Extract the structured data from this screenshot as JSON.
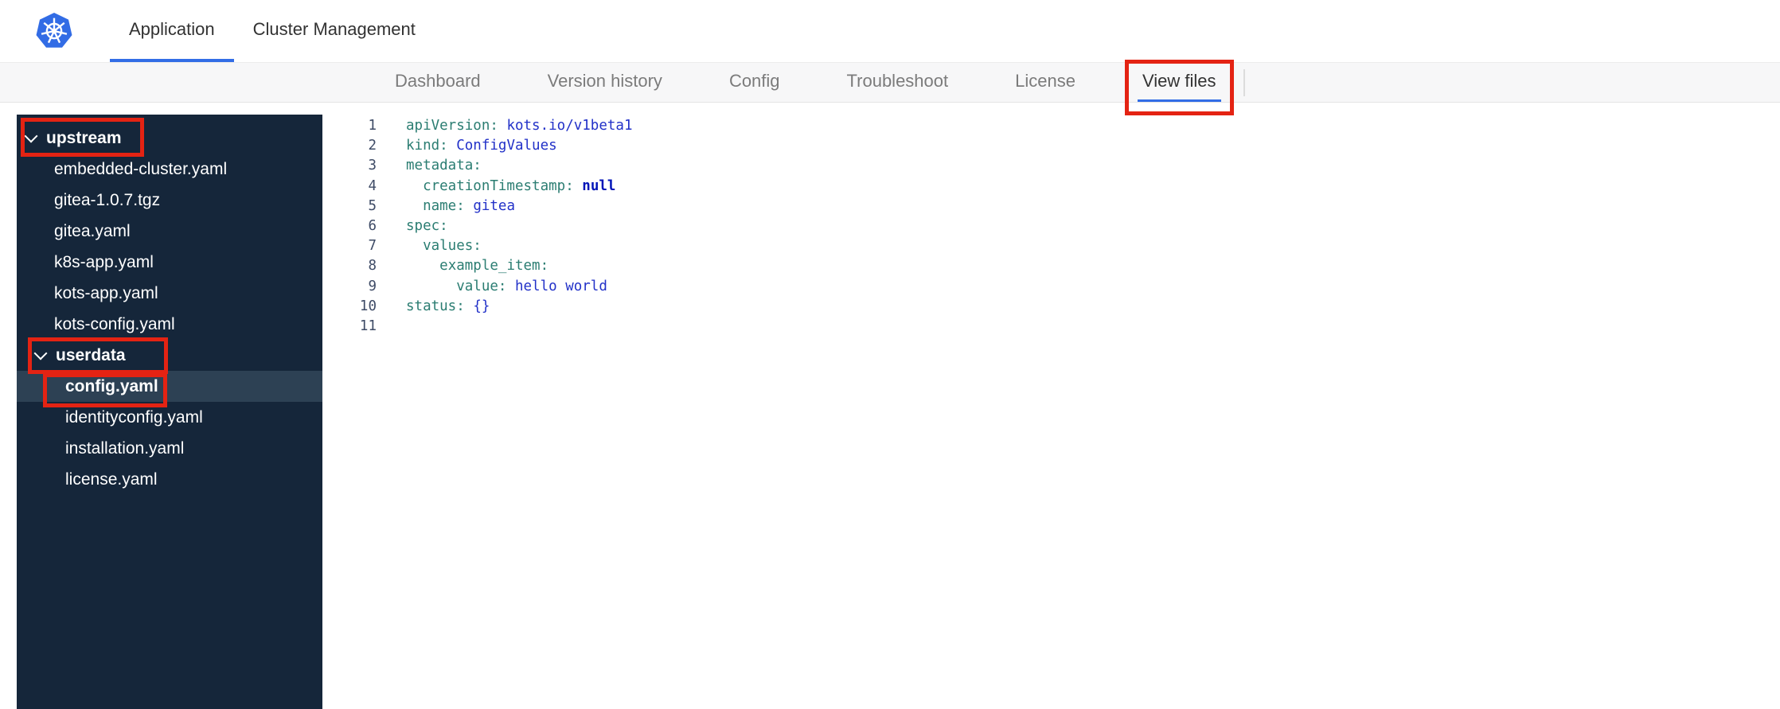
{
  "header": {
    "tabs": [
      {
        "label": "Application",
        "active": true
      },
      {
        "label": "Cluster Management",
        "active": false
      }
    ]
  },
  "subnav": {
    "items": [
      {
        "label": "Dashboard",
        "active": false
      },
      {
        "label": "Version history",
        "active": false
      },
      {
        "label": "Config",
        "active": false
      },
      {
        "label": "Troubleshoot",
        "active": false
      },
      {
        "label": "License",
        "active": false
      },
      {
        "label": "View files",
        "active": true,
        "annotated": true
      }
    ]
  },
  "file_tree": {
    "items": [
      {
        "label": "upstream",
        "type": "folder",
        "indent": 0,
        "expanded": true,
        "annotated": true
      },
      {
        "label": "embedded-cluster.yaml",
        "type": "file",
        "indent": 1
      },
      {
        "label": "gitea-1.0.7.tgz",
        "type": "file",
        "indent": 1
      },
      {
        "label": "gitea.yaml",
        "type": "file",
        "indent": 1
      },
      {
        "label": "k8s-app.yaml",
        "type": "file",
        "indent": 1
      },
      {
        "label": "kots-app.yaml",
        "type": "file",
        "indent": 1
      },
      {
        "label": "kots-config.yaml",
        "type": "file",
        "indent": 1
      },
      {
        "label": "userdata",
        "type": "folder",
        "indent": 1,
        "expanded": true,
        "annotated": true
      },
      {
        "label": "config.yaml",
        "type": "file",
        "indent": 2,
        "selected": true,
        "annotated": true
      },
      {
        "label": "identityconfig.yaml",
        "type": "file",
        "indent": 2
      },
      {
        "label": "installation.yaml",
        "type": "file",
        "indent": 2
      },
      {
        "label": "license.yaml",
        "type": "file",
        "indent": 2
      }
    ]
  },
  "editor": {
    "lines": [
      {
        "num": "1",
        "tokens": [
          {
            "t": "apiVersion:",
            "c": "key"
          },
          {
            "t": " ",
            "c": "plain"
          },
          {
            "t": "kots.io/v1beta1",
            "c": "val"
          }
        ]
      },
      {
        "num": "2",
        "tokens": [
          {
            "t": "kind:",
            "c": "key"
          },
          {
            "t": " ",
            "c": "plain"
          },
          {
            "t": "ConfigValues",
            "c": "val"
          }
        ]
      },
      {
        "num": "3",
        "tokens": [
          {
            "t": "metadata:",
            "c": "key"
          }
        ]
      },
      {
        "num": "4",
        "tokens": [
          {
            "t": "  ",
            "c": "plain"
          },
          {
            "t": "creationTimestamp:",
            "c": "key"
          },
          {
            "t": " ",
            "c": "plain"
          },
          {
            "t": "null",
            "c": "keyword"
          }
        ]
      },
      {
        "num": "5",
        "tokens": [
          {
            "t": "  ",
            "c": "plain"
          },
          {
            "t": "name:",
            "c": "key"
          },
          {
            "t": " ",
            "c": "plain"
          },
          {
            "t": "gitea",
            "c": "val"
          }
        ]
      },
      {
        "num": "6",
        "tokens": [
          {
            "t": "spec:",
            "c": "key"
          }
        ]
      },
      {
        "num": "7",
        "tokens": [
          {
            "t": "  ",
            "c": "plain"
          },
          {
            "t": "values:",
            "c": "key"
          }
        ]
      },
      {
        "num": "8",
        "tokens": [
          {
            "t": "    ",
            "c": "plain"
          },
          {
            "t": "example_item:",
            "c": "key"
          }
        ]
      },
      {
        "num": "9",
        "tokens": [
          {
            "t": "      ",
            "c": "plain"
          },
          {
            "t": "value:",
            "c": "key"
          },
          {
            "t": " ",
            "c": "plain"
          },
          {
            "t": "hello world",
            "c": "val"
          }
        ]
      },
      {
        "num": "10",
        "tokens": [
          {
            "t": "status:",
            "c": "key"
          },
          {
            "t": " ",
            "c": "plain"
          },
          {
            "t": "{}",
            "c": "val"
          }
        ]
      },
      {
        "num": "11",
        "tokens": []
      }
    ]
  },
  "annotations": {
    "highlighted": [
      "View files",
      "upstream",
      "userdata",
      "config.yaml"
    ],
    "color": "#e42313"
  },
  "colors": {
    "accent_blue": "#326de6",
    "sidebar_bg": "#15263a",
    "selected_row_bg": "#2d4154",
    "code_key": "#2b7d72",
    "code_value": "#2231c8",
    "code_keyword": "#0014b8"
  }
}
